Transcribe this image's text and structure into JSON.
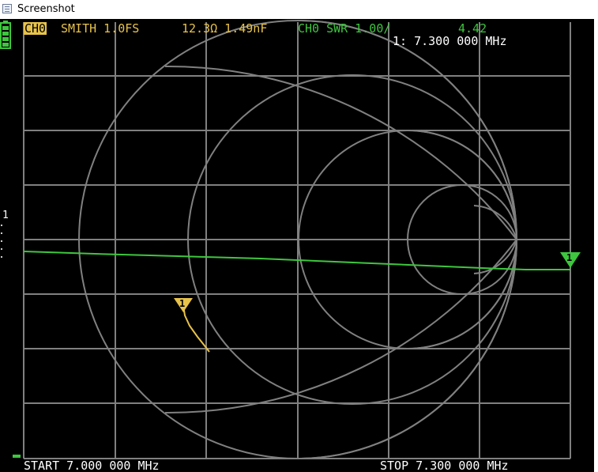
{
  "window": {
    "title": "Screenshot",
    "icon": "screenshot-app-icon"
  },
  "colors": {
    "background": "#000000",
    "grid": "#808080",
    "ch0_trace": "#e8c34a",
    "ch1_trace": "#3ec63e",
    "text": "#ffffff"
  },
  "header": {
    "ch0_label": "CH0",
    "ch0_format": "SMITH 1.0FS",
    "ch0_value": "12.3Ω 1.49nF",
    "ch1_label": "CH0 SWR 1.00/",
    "ch1_value": "4.42",
    "marker_readout": "1: 7.300 000 MHz"
  },
  "left_panel": {
    "reference_label": "1",
    "battery_icon": "battery-icon"
  },
  "markers": {
    "ch0_marker_label": "1",
    "ch1_marker_label": "1"
  },
  "footer": {
    "start_label": "START 7.000 000 MHz",
    "stop_label": "STOP 7.300 000 MHz"
  }
}
